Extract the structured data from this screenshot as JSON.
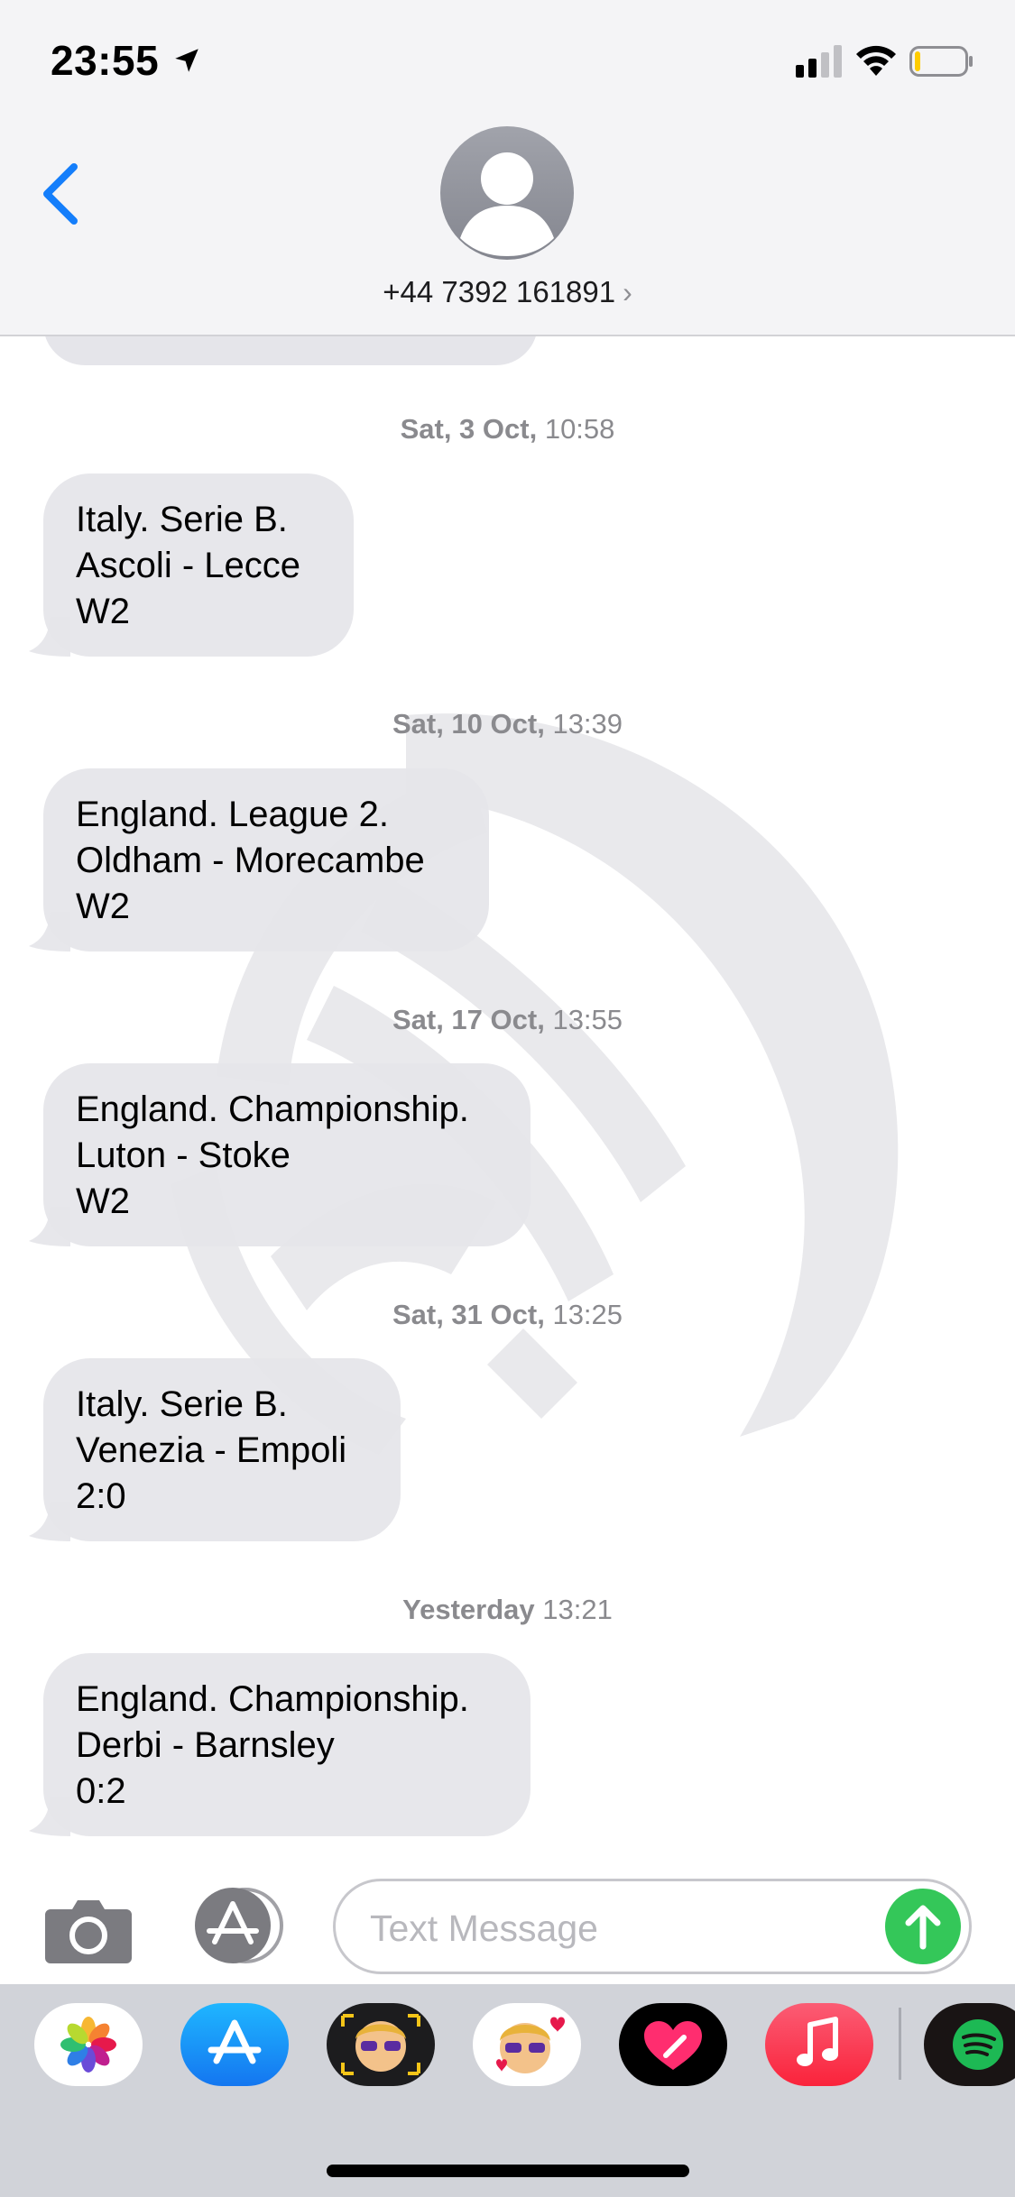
{
  "status_bar": {
    "time": "23:55"
  },
  "header": {
    "contact": "+44 7392 161891",
    "chevron": "›"
  },
  "messages": [
    {
      "date": "Sat, 3 Oct,",
      "time": "10:58",
      "lines": [
        "Italy. Serie B.",
        "Ascoli - Lecce",
        "W2"
      ]
    },
    {
      "date": "Sat, 10 Oct,",
      "time": "13:39",
      "lines": [
        "England. League 2.",
        "Oldham - Morecambe",
        "W2"
      ]
    },
    {
      "date": "Sat, 17 Oct,",
      "time": "13:55",
      "lines": [
        "England. Championship.",
        "Luton - Stoke",
        "W2"
      ]
    },
    {
      "date": "Sat, 31 Oct,",
      "time": "13:25",
      "lines": [
        "Italy. Serie B.",
        "Venezia - Empoli",
        "2:0"
      ]
    },
    {
      "date": "Yesterday",
      "time": "13:21",
      "lines": [
        "England. Championship.",
        "Derbi - Barnsley",
        "0:2"
      ]
    }
  ],
  "input": {
    "placeholder": "Text Message",
    "value": ""
  },
  "apps": [
    "photos-icon",
    "app-store-icon",
    "memoji-glasses-icon",
    "memoji-hearts-icon",
    "digital-touch-icon",
    "music-icon",
    "spotify-icon"
  ],
  "colors": {
    "accent_blue": "#147efb",
    "send_green": "#34c759",
    "bubble_gray": "#e5e5ea"
  }
}
